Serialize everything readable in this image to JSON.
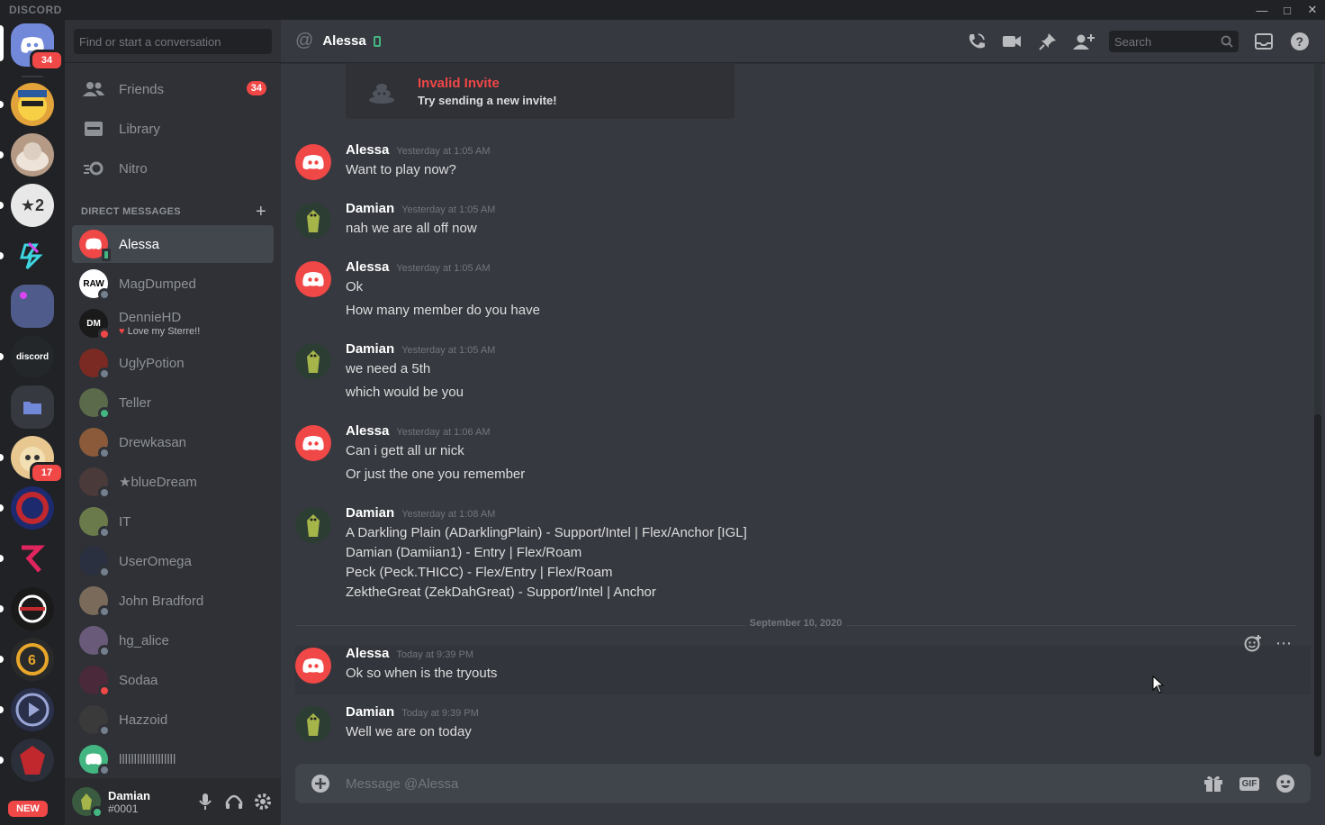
{
  "app": {
    "brand": "DISCORD",
    "window_buttons": [
      "minimize",
      "maximize",
      "close"
    ]
  },
  "servers": {
    "home_badge": "34",
    "items": [
      {
        "name": "server-1"
      },
      {
        "name": "server-2"
      },
      {
        "name": "server-3-ranking"
      },
      {
        "name": "server-4"
      },
      {
        "name": "server-5"
      },
      {
        "name": "discord-bio",
        "label": "discord"
      },
      {
        "name": "folder"
      },
      {
        "name": "server-7",
        "badge": "17"
      },
      {
        "name": "server-8"
      },
      {
        "name": "server-9"
      },
      {
        "name": "server-10"
      },
      {
        "name": "server-11"
      },
      {
        "name": "server-12"
      },
      {
        "name": "server-13"
      }
    ],
    "new_badge": "NEW"
  },
  "sidebar": {
    "search_placeholder": "Find or start a conversation",
    "nav": [
      {
        "label": "Friends",
        "badge": "34"
      },
      {
        "label": "Library"
      },
      {
        "label": "Nitro"
      }
    ],
    "dm_header": "DIRECT MESSAGES",
    "dms": [
      {
        "name": "Alessa",
        "status": "mobile",
        "active": true,
        "color": "#f04747"
      },
      {
        "name": "MagDumped",
        "status": "offline",
        "color": "#ffffff",
        "text": "RAW"
      },
      {
        "name": "DennieHD",
        "status": "dnd",
        "sub": "Love my Sterre!!",
        "color": "#1a1a1a",
        "text": "DM"
      },
      {
        "name": "UglyPotion",
        "status": "offline",
        "color": "#7a2a22"
      },
      {
        "name": "Teller",
        "status": "online",
        "color": "#5a6a4a"
      },
      {
        "name": "Drewkasan",
        "status": "offline",
        "color": "#8a5a3a"
      },
      {
        "name": "★blueDream",
        "status": "offline",
        "color": "#4a3a3a"
      },
      {
        "name": "IT",
        "status": "offline",
        "color": "#6a7a4a"
      },
      {
        "name": "UserOmega",
        "status": "offline",
        "color": "#2a3040"
      },
      {
        "name": "John Bradford",
        "status": "offline",
        "color": "#7a6a5a"
      },
      {
        "name": "hg_alice",
        "status": "offline",
        "color": "#6a5a7a"
      },
      {
        "name": "Sodaa",
        "status": "dnd",
        "color": "#4a2a3a"
      },
      {
        "name": "Hazzoid",
        "status": "offline",
        "color": "#3a3a3a"
      },
      {
        "name": "lllllllllllllllllll",
        "status": "offline",
        "color": "#43b581"
      }
    ],
    "user": {
      "name": "Damian",
      "tag": "#0001"
    }
  },
  "chat": {
    "channel": "Alessa",
    "search_placeholder": "Search",
    "invite": {
      "title": "Invalid Invite",
      "sub": "Try sending a new invite!"
    },
    "messages": [
      {
        "author": "Alessa",
        "ts": "Yesterday at 1:05 AM",
        "lines": [
          "Want to play now?"
        ]
      },
      {
        "author": "Damian",
        "ts": "Yesterday at 1:05 AM",
        "lines": [
          "nah we are all off now"
        ]
      },
      {
        "author": "Alessa",
        "ts": "Yesterday at 1:05 AM",
        "lines": [
          "Ok",
          "How many member do you have"
        ]
      },
      {
        "author": "Damian",
        "ts": "Yesterday at 1:05 AM",
        "lines": [
          "we need a 5th",
          "which would be you"
        ]
      },
      {
        "author": "Alessa",
        "ts": "Yesterday at 1:06 AM",
        "lines": [
          "Can i gett all ur nick",
          "Or just the one you remember"
        ]
      },
      {
        "author": "Damian",
        "ts": "Yesterday at 1:08 AM",
        "lines": [
          "A Darkling Plain (ADarklingPlain) - Support/Intel | Flex/Anchor [IGL]",
          "Damian (Damiian1) - Entry | Flex/Roam",
          "Peck (Peck.THICC) - Flex/Entry | Flex/Roam",
          "ZektheGreat (ZekDahGreat) - Support/Intel | Anchor"
        ]
      },
      {
        "author": "Alessa",
        "ts": "Today at 9:39 PM",
        "lines": [
          "Ok so when is the tryouts"
        ]
      },
      {
        "author": "Damian",
        "ts": "Today at 9:39 PM",
        "lines": [
          "Well we are on today"
        ]
      }
    ],
    "date_divider": "September 10, 2020",
    "composer_placeholder": "Message @Alessa",
    "gif_label": "GIF"
  },
  "colors": {
    "accent": "#7289da",
    "danger": "#f04747",
    "online": "#43b581"
  }
}
